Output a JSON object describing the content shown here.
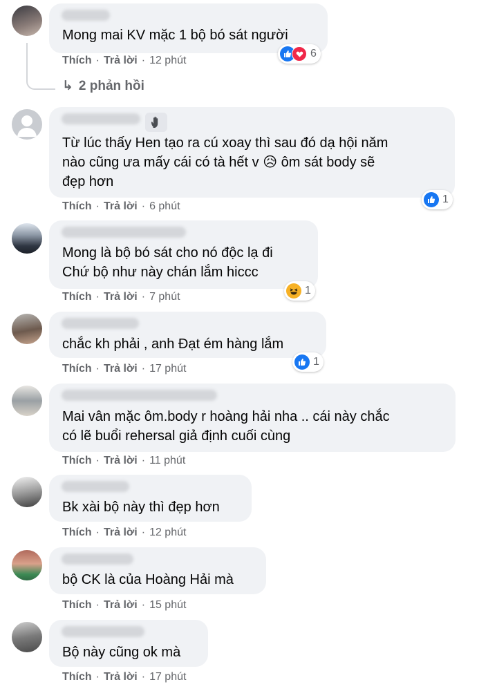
{
  "comments": [
    {
      "text_lines": [
        "Mong mai KV mặc 1 bộ bó sát người"
      ],
      "like_label": "Thích",
      "reply_label": "Trả lời",
      "time": "12 phút",
      "reaction_count": "6",
      "reactions": [
        "like",
        "love"
      ],
      "replies_label": "2 phản hồi"
    },
    {
      "text_lines": [
        "Từ lúc thấy Hen tạo ra cú xoay thì sau đó dạ hội năm",
        "nào cũng ưa mấy cái có tà hết v 😥 ôm sát body sẽ",
        "đẹp hơn"
      ],
      "like_label": "Thích",
      "reply_label": "Trả lời",
      "time": "6 phút",
      "reaction_count": "1",
      "reactions": [
        "like"
      ],
      "badge": "wave"
    },
    {
      "text_lines": [
        "Mong là bộ bó sát cho nó độc lạ đi",
        "Chứ bộ như này chán lắm hiccc"
      ],
      "like_label": "Thích",
      "reply_label": "Trả lời",
      "time": "7 phút",
      "reaction_count": "1",
      "reactions": [
        "haha"
      ]
    },
    {
      "text_lines": [
        "chắc kh phải , anh Đạt ém hàng lắm"
      ],
      "like_label": "Thích",
      "reply_label": "Trả lời",
      "time": "17 phút",
      "reaction_count": "1",
      "reactions": [
        "like"
      ]
    },
    {
      "text_lines": [
        "Mai vân mặc ôm.body r hoàng hải nha .. cái này chắc",
        "có lẽ buổi rehersal giả định cuối cùng"
      ],
      "like_label": "Thích",
      "reply_label": "Trả lời",
      "time": "11 phút"
    },
    {
      "text_lines": [
        "Bk xài bộ này thì đẹp hơn"
      ],
      "like_label": "Thích",
      "reply_label": "Trả lời",
      "time": "12 phút"
    },
    {
      "text_lines": [
        "bộ CK là của Hoàng Hải mà"
      ],
      "like_label": "Thích",
      "reply_label": "Trả lời",
      "time": "15 phút"
    },
    {
      "text_lines": [
        "Bộ này cũng ok mà"
      ],
      "like_label": "Thích",
      "reply_label": "Trả lời",
      "time": "17 phút"
    }
  ],
  "colors": {
    "bubble": "#f0f2f5",
    "meta": "#65676b",
    "like": "#1877f2",
    "love": "#f02849",
    "haha": "#f7b125"
  }
}
